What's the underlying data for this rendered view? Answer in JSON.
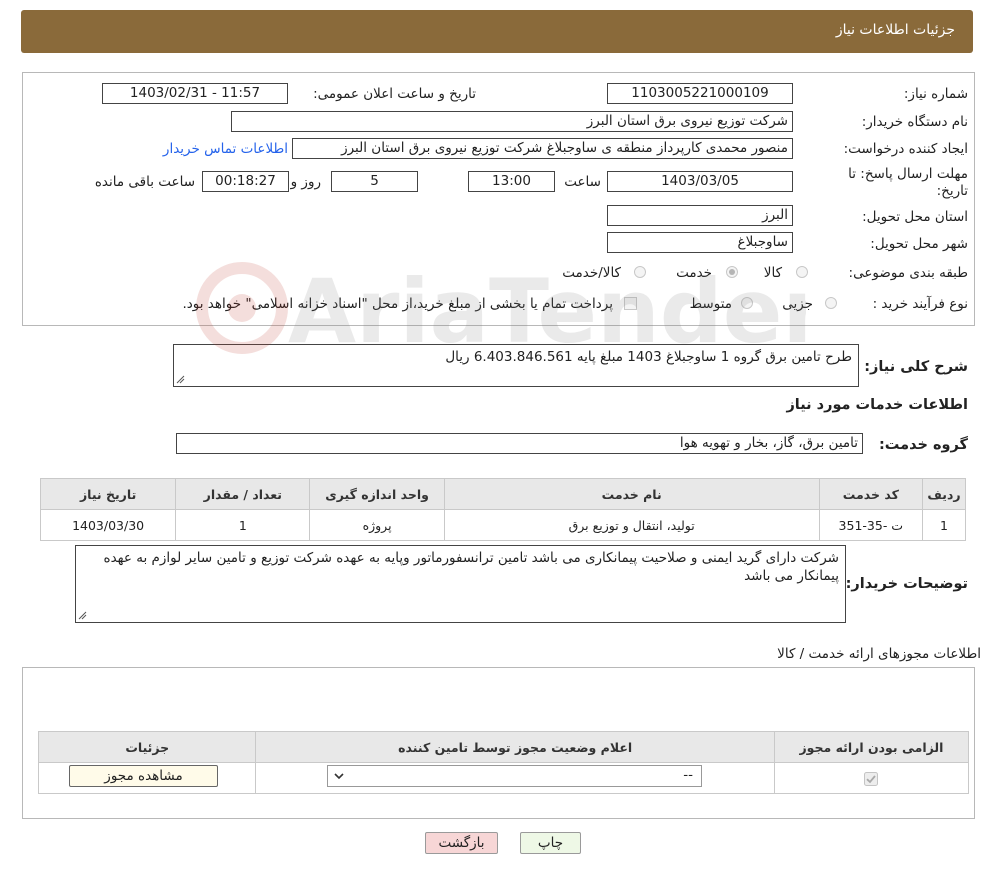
{
  "header": {
    "title": "جزئیات اطلاعات نیاز"
  },
  "form": {
    "need_number_label": "شماره نیاز:",
    "need_number": "1103005221000109",
    "announce_label": "تاریخ و ساعت اعلان عمومی:",
    "announce_value": "1403/02/31 - 11:57",
    "buyer_org_label": "نام دستگاه خریدار:",
    "buyer_org": "شرکت توزیع نیروی برق استان البرز",
    "requester_label": "ایجاد کننده درخواست:",
    "requester": "منصور محمدی کارپرداز منطقه ی ساوجبلاغ شرکت توزیع نیروی برق استان البرز",
    "contact_link": "اطلاعات تماس خریدار",
    "deadline_label_1": "مهلت ارسال پاسخ: تا",
    "deadline_label_2": "تاریخ:",
    "deadline_date": "1403/03/05",
    "time_label": "ساعت",
    "deadline_time": "13:00",
    "days_value": "5",
    "days_label": "روز و",
    "remaining_time": "00:18:27",
    "remaining_label": "ساعت باقی مانده",
    "province_label": "استان محل تحویل:",
    "province": "البرز",
    "city_label": "شهر محل تحویل:",
    "city": "ساوجبلاغ",
    "category_label": "طبقه بندی موضوعی:",
    "category_options": [
      "کالا",
      "خدمت",
      "کالا/خدمت"
    ],
    "category_selected": "خدمت",
    "process_label": "نوع فرآیند خرید :",
    "process_options": [
      "جزیی",
      "متوسط"
    ],
    "payment_note": "پرداخت تمام یا بخشی از مبلغ خرید،از محل \"اسناد خزانه اسلامی\" خواهد بود."
  },
  "summary": {
    "label": "شرح کلی نیاز:",
    "text": "طرح تامین برق گروه 1 ساوجبلاغ 1403 مبلغ پایه 6.403.846.561 ریال"
  },
  "services": {
    "section_title": "اطلاعات خدمات مورد نیاز",
    "group_label": "گروه خدمت:",
    "group_value": "تامین برق، گاز، بخار و تهویه هوا",
    "columns": [
      "ردیف",
      "کد خدمت",
      "نام خدمت",
      "واحد اندازه گیری",
      "تعداد / مقدار",
      "تاریخ نیاز"
    ],
    "rows": [
      [
        "1",
        "ت -35-351",
        "تولید، انتقال و توزیع برق",
        "پروژه",
        "1",
        "1403/03/30"
      ]
    ]
  },
  "buyer_notes": {
    "label": "توضیحات خریدار:",
    "text": "شرکت دارای گرید ایمنی و صلاحیت پیمانکاری می باشد تامین ترانسفورماتور  وپایه به عهده شرکت توزیع و تامین سایر لوازم به عهده پیمانکار می باشد"
  },
  "permits": {
    "section_title": "اطلاعات مجوزهای ارائه خدمت / کالا",
    "columns": [
      "الزامی بودن ارائه مجوز",
      "اعلام وضعیت مجوز توسط تامین کننده",
      "جزئیات"
    ],
    "select_value": "--",
    "view_button": "مشاهده مجوز"
  },
  "actions": {
    "print": "چاپ",
    "back": "بازگشت"
  },
  "watermark": {
    "text": "AriaTender.net"
  },
  "colors": {
    "header_bg": "#8a6a3a",
    "link": "#2563eb",
    "back_btn_bg": "#f7d6d6",
    "print_btn_bg": "#eef8e6"
  }
}
